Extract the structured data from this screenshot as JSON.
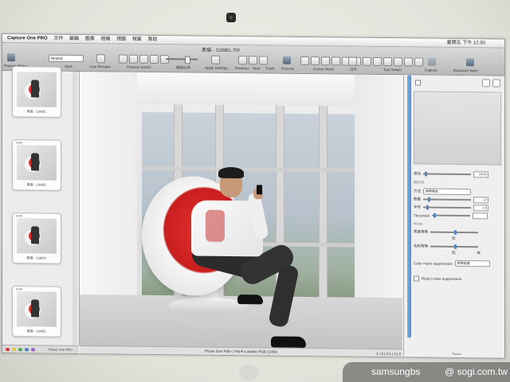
{
  "menubar": {
    "app_name": "Capture One PRO",
    "menus": [
      "文件",
      "編輯",
      "圖像",
      "相機",
      "視圖",
      "視窗",
      "幫助"
    ],
    "clock": "星期五 下午 12:50"
  },
  "window": {
    "document_title": "黑貓 - 1199EL.TIF"
  },
  "toolbar": {
    "preset_select": "Neutral",
    "labels": {
      "process_rules": "Process Rules",
      "style": "Style",
      "live_preview": "Live Preview",
      "preview_switch": "Preview Switch",
      "zoom": "縮放比例",
      "apply_settings": "Apply Settings",
      "previous": "Previous",
      "next": "Next",
      "trash": "Trash",
      "process": "Process",
      "cursor_mode": "Cursor Mode",
      "white_balance": "白平",
      "tool_switch": "Tool Switch",
      "capture": "Capture",
      "exposure": "Exposure Warn"
    }
  },
  "browser": {
    "thumbnails": [
      {
        "tag": "",
        "caption": "黑貓 - 1199EL"
      },
      {
        "tag": "Grab",
        "caption": "黑貓 - 1199EL"
      },
      {
        "tag": "Grab",
        "caption": "黑貓 - 11980C"
      },
      {
        "tag": "Grab",
        "caption": "黑貓 - 1198EL"
      }
    ],
    "footer_label": "Phase One PRO"
  },
  "viewer": {
    "status": "Phase One P45+ | PanF ▸ Adobe RGB (1998)",
    "zoom_readout": "1 / 4 | 4:1 | 3 | 8"
  },
  "tools": {
    "rows": {
      "contrast_label": "總加",
      "contrast_value": "100%",
      "section_sharpen": "銳利化",
      "method_label": "方法",
      "method_value": "標準模式",
      "amount_label": "數量",
      "amount_value": "22",
      "radius_label": "半徑",
      "radius_value": "1.8",
      "threshold_label": "Threshold",
      "threshold_value": "",
      "noise_section": "Noise",
      "luminance_label": "亮度降噪",
      "color_label": "色彩降噪",
      "low": "低",
      "high": "高",
      "color_moire_label": "Color moire suppression",
      "color_moire_value": "標準設置",
      "reject_noise_label": "Reject noise suppression",
      "footer": "Focus"
    }
  },
  "watermark": {
    "left": "samsungbs",
    "right": "@ sogi.com.tw"
  },
  "colors": {
    "chair_red": "#d22b2b",
    "scroll_blue": "#4c8fd6",
    "watermark_bg": "#555555"
  }
}
